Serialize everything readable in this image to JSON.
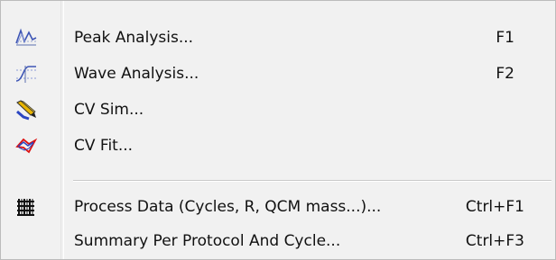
{
  "menu": {
    "items": [
      {
        "label": "Peak Analysis...",
        "shortcut": "F1",
        "icon": "peak-analysis-icon"
      },
      {
        "label": "Wave Analysis...",
        "shortcut": "F2",
        "icon": "wave-analysis-icon"
      },
      {
        "label": "CV Sim...",
        "shortcut": "",
        "icon": "cv-sim-icon"
      },
      {
        "label": "CV Fit...",
        "shortcut": "",
        "icon": "cv-fit-icon"
      },
      {
        "label": "Process Data (Cycles, R, QCM mass...)...",
        "shortcut": "Ctrl+F1",
        "icon": "process-data-icon"
      },
      {
        "label": "Summary Per Protocol And Cycle...",
        "shortcut": "Ctrl+F3",
        "icon": ""
      }
    ]
  }
}
